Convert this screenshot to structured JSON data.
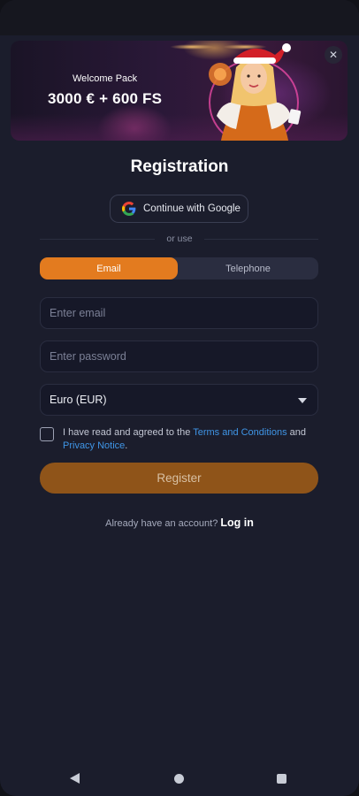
{
  "banner": {
    "subtitle": "Welcome Pack",
    "title": "3000 € + 600 FS",
    "close_icon": "close-icon",
    "art": "santa-hat-girl-illustration"
  },
  "page": {
    "title": "Registration"
  },
  "google": {
    "label": "Continue with Google",
    "icon": "google-icon"
  },
  "divider_text": "or use",
  "tabs": [
    {
      "label": "Email",
      "active": true
    },
    {
      "label": "Telephone",
      "active": false
    }
  ],
  "form": {
    "email_placeholder": "Enter email",
    "password_placeholder": "Enter password",
    "currency_value": "Euro (EUR)",
    "terms_prefix": "I have read and agreed to the ",
    "terms_link": "Terms and Conditions",
    "terms_and": " and",
    "privacy_link": "Privacy Notice",
    "terms_suffix": ".",
    "register_label": "Register"
  },
  "login": {
    "prompt": "Already have an account? ",
    "link": "Log in"
  },
  "nav": {
    "back_icon": "back-triangle-icon",
    "home_icon": "home-circle-icon",
    "recents_icon": "recents-square-icon"
  },
  "colors": {
    "background": "#1b1d2c",
    "accent": "#e37b1f",
    "register_button": "#8f5419",
    "link": "#3f95e6",
    "field_bg": "#161828"
  }
}
